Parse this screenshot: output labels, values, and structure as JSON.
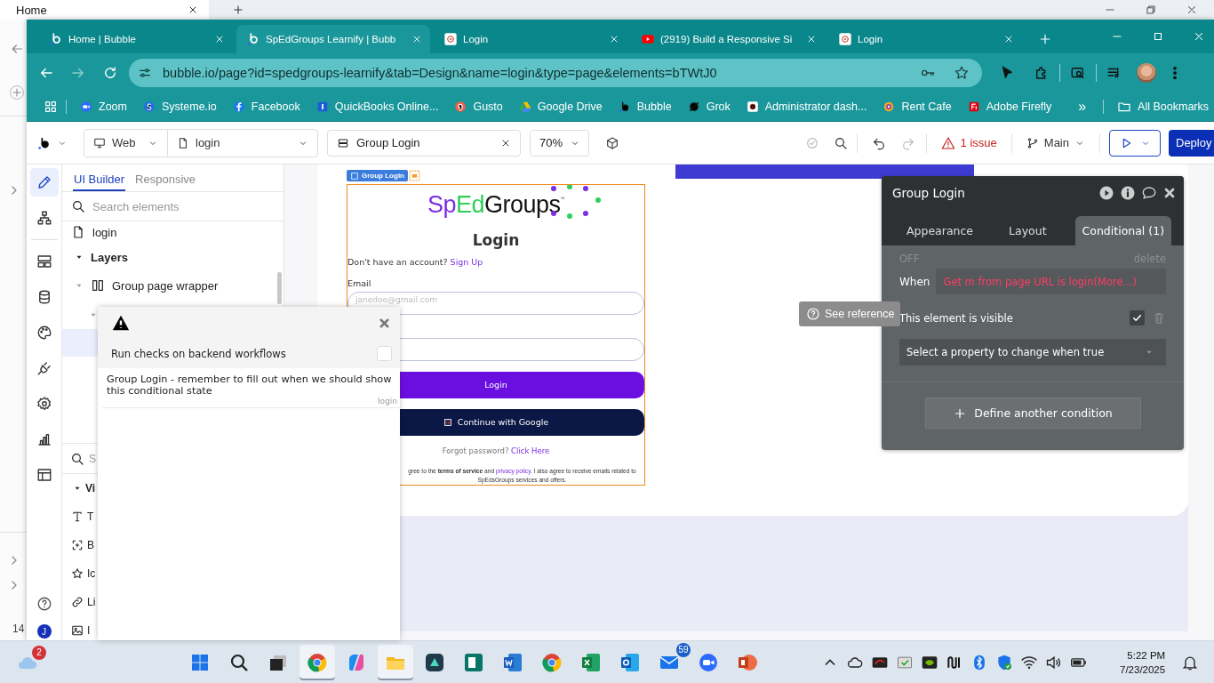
{
  "desktop": {
    "back_tab": "Home",
    "partial_number": "14"
  },
  "browser": {
    "tabs": [
      {
        "title": "Home | Bubble",
        "selected": false
      },
      {
        "title": "SpEdGroups Learnify | Bubb",
        "selected": true
      },
      {
        "title": "Login",
        "selected": false
      },
      {
        "title": "(2919) Build a Responsive Si",
        "selected": false
      },
      {
        "title": "Login",
        "selected": false
      }
    ],
    "url": "bubble.io/page?id=spedgroups-learnify&tab=Design&name=login&type=page&elements=bTWtJ0",
    "bookmarks": [
      {
        "label": "Zoom"
      },
      {
        "label": "Systeme.io"
      },
      {
        "label": "Facebook"
      },
      {
        "label": "QuickBooks Online..."
      },
      {
        "label": "Gusto"
      },
      {
        "label": "Google Drive"
      },
      {
        "label": "Bubble"
      },
      {
        "label": "Grok"
      },
      {
        "label": "Administrator dash..."
      },
      {
        "label": "Rent Cafe"
      },
      {
        "label": "Adobe Firefly"
      }
    ],
    "more": "»",
    "all_bookmarks": "All Bookmarks"
  },
  "editor": {
    "toolbar": {
      "device": "Web",
      "page": "login",
      "element": "Group Login",
      "zoom": "70%",
      "issues": "1 issue",
      "branch": "Main",
      "deploy": "Deploy"
    },
    "rail": [
      {
        "selected": true
      },
      {
        "selected": false
      },
      {
        "selected": false
      },
      {
        "selected": false
      },
      {
        "selected": false
      },
      {
        "selected": false
      },
      {
        "selected": false
      },
      {
        "selected": false
      },
      {
        "selected": false
      }
    ],
    "user_initial": "J",
    "panel": {
      "tabs": [
        {
          "label": "UI Builder",
          "selected": true
        },
        {
          "label": "Responsive",
          "selected": false
        }
      ],
      "search_placeholder": "Search elements",
      "page": "login",
      "layers": {
        "label": "Layers",
        "expanded": true,
        "children": [
          {
            "label": "Group page wrapper",
            "expanded": true,
            "children": [
              {
                "expanded": true,
                "selected": false
              },
              {
                "selected": true
              }
            ]
          }
        ]
      },
      "search2_placeholder": "S",
      "section": {
        "label": "Vi",
        "expanded": true
      },
      "elements": [
        {
          "label": "T"
        },
        {
          "label": "B"
        },
        {
          "label": "Ic"
        },
        {
          "label": "Li"
        },
        {
          "label": "I"
        }
      ]
    },
    "canvas": {
      "group_tag": "Group Login",
      "logo": [
        {
          "text": "Sp",
          "color": "#7b2fe3"
        },
        {
          "text": "Ed",
          "color": "#2fd05a"
        },
        {
          "text": "Groups",
          "color": "#111111"
        }
      ],
      "logo_mark": "™",
      "heading": "Login",
      "signup_prompt": "Don't have an account?",
      "signup_link": "Sign Up",
      "email_label": "Email",
      "email_placeholder": "janedoe@gmail.com",
      "login_button": "Login",
      "google_button": "Continue with Google",
      "forgot_prompt": "Forgot password?",
      "forgot_link": "Click Here",
      "terms": [
        {
          "text": "gree to the ",
          "kind": "plain"
        },
        {
          "text": "terms of service",
          "kind": "bold"
        },
        {
          "text": " and ",
          "kind": "plain"
        },
        {
          "text": "privacy policy",
          "kind": "link"
        },
        {
          "text": ". I also agree to receive emails related to SpEdsGroups services and offers.",
          "kind": "plain"
        }
      ]
    },
    "tooltip": "See reference",
    "issues_popup": {
      "option": "Run checks on backend workflows",
      "checked": false,
      "issues": [
        {
          "message": "Group Login - remember to fill out when we should show this conditional state",
          "page": "login"
        }
      ]
    },
    "property_editor": {
      "title": "Group Login",
      "tabs": [
        {
          "label": "Appearance",
          "selected": false
        },
        {
          "label": "Layout",
          "selected": false
        },
        {
          "label": "Conditional (1)",
          "selected": true
        }
      ],
      "status": "OFF",
      "delete": "delete",
      "when_label": "When",
      "condition": "Get m from page URL is login(More...)",
      "property": "This element is visible",
      "property_checked": true,
      "select_placeholder": "Select a property to change when true",
      "add_button": "Define another condition"
    }
  },
  "taskbar": {
    "weather_badge": "2",
    "apps": [
      {
        "active": false
      },
      {
        "active": false
      },
      {
        "active": false
      },
      {
        "active": true
      },
      {
        "active": false
      },
      {
        "active": true
      },
      {
        "active": false
      },
      {
        "active": false
      },
      {
        "active": false
      },
      {
        "active": false
      },
      {
        "active": false
      },
      {
        "active": false
      },
      {
        "active": false,
        "badge": "59"
      },
      {
        "active": false
      },
      {
        "active": false
      }
    ],
    "time": "5:22 PM",
    "date": "7/23/2025"
  }
}
